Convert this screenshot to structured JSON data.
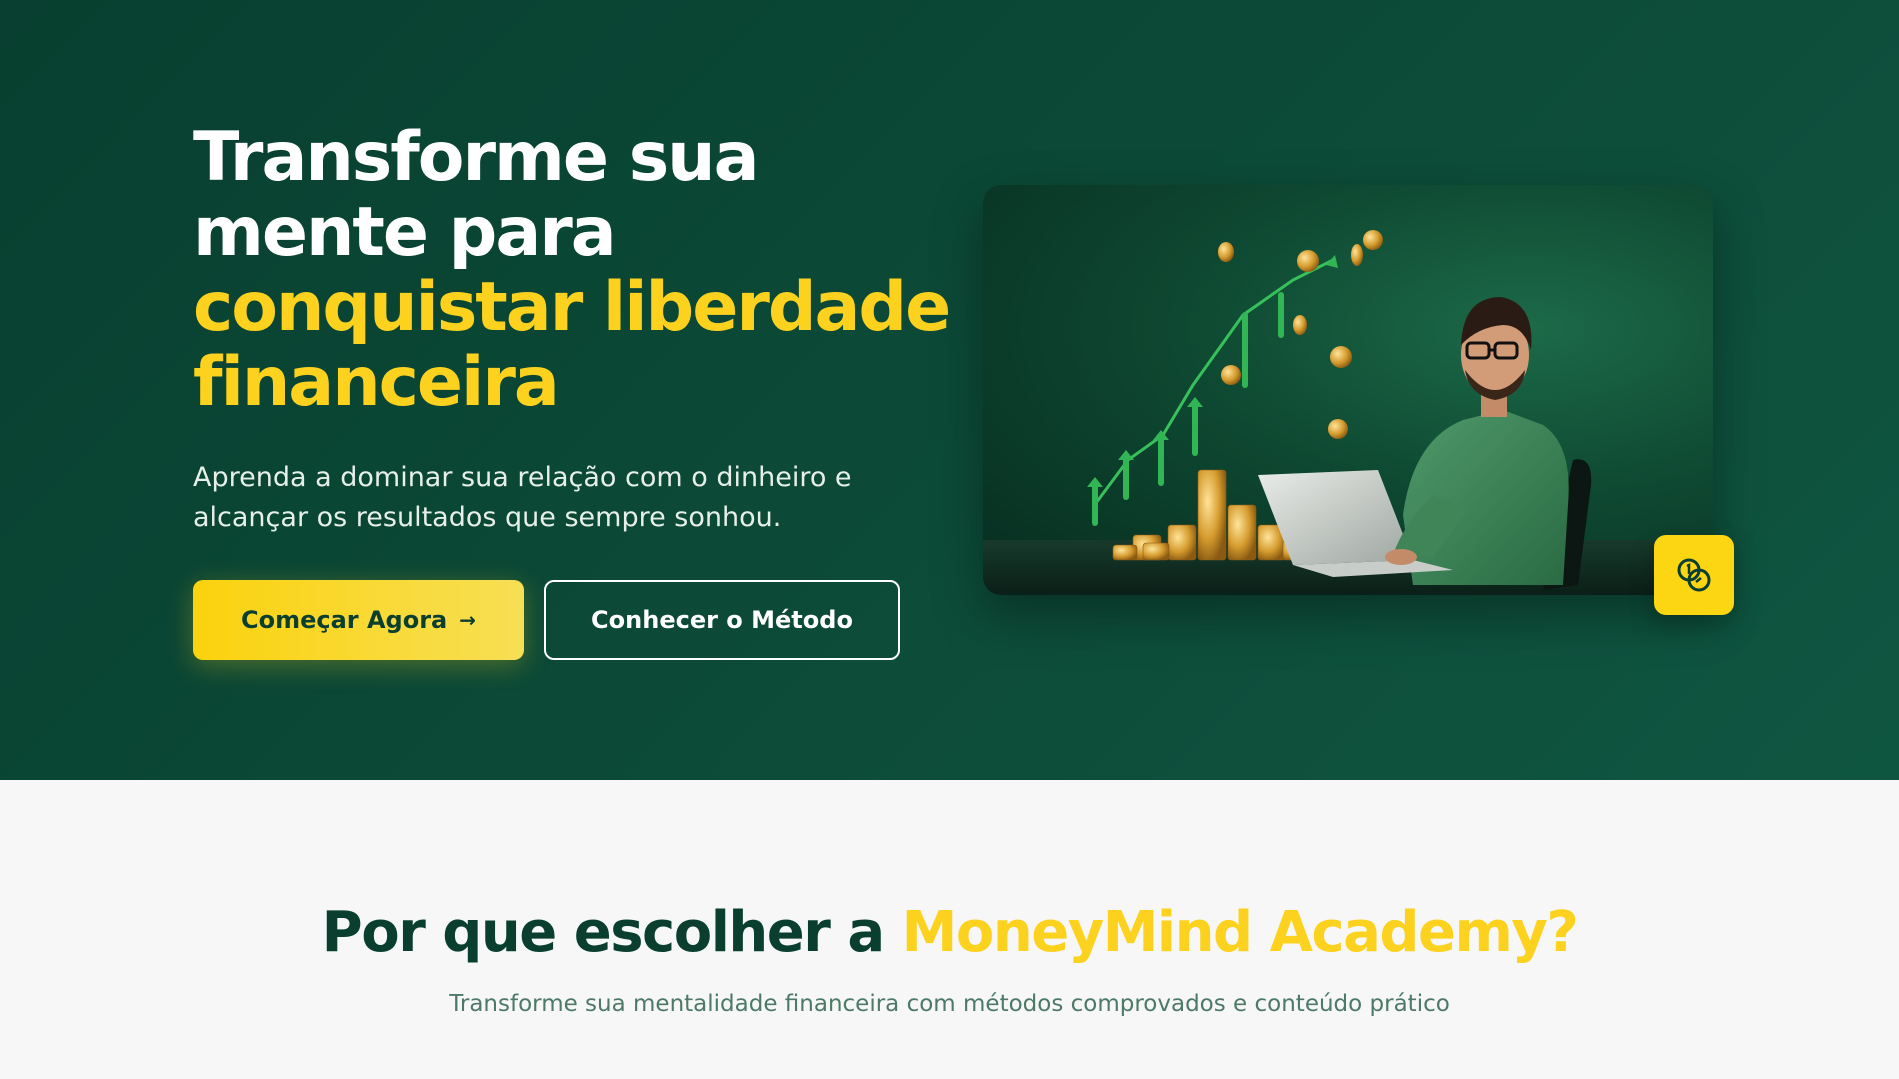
{
  "hero": {
    "title_line1": "Transforme sua",
    "title_line2": "mente para",
    "title_accent_line1": "conquistar liberdade",
    "title_accent_line2": "financeira",
    "subtitle": "Aprenda a dominar sua relação com o dinheiro e alcançar os resultados que sempre sonhou.",
    "primary_button": "Começar Agora",
    "primary_button_icon": "→",
    "secondary_button": "Conhecer o Método",
    "image_icon": "coins-icon"
  },
  "why": {
    "title_prefix": "Por que escolher a",
    "title_accent": "MoneyMind Academy?",
    "subtitle": "Transforme sua mentalidade financeira com métodos comprovados e conteúdo prático"
  },
  "colors": {
    "hero_bg": "#0c4a37",
    "accent": "#fcd21f",
    "dark_green": "#0a3e2e"
  }
}
